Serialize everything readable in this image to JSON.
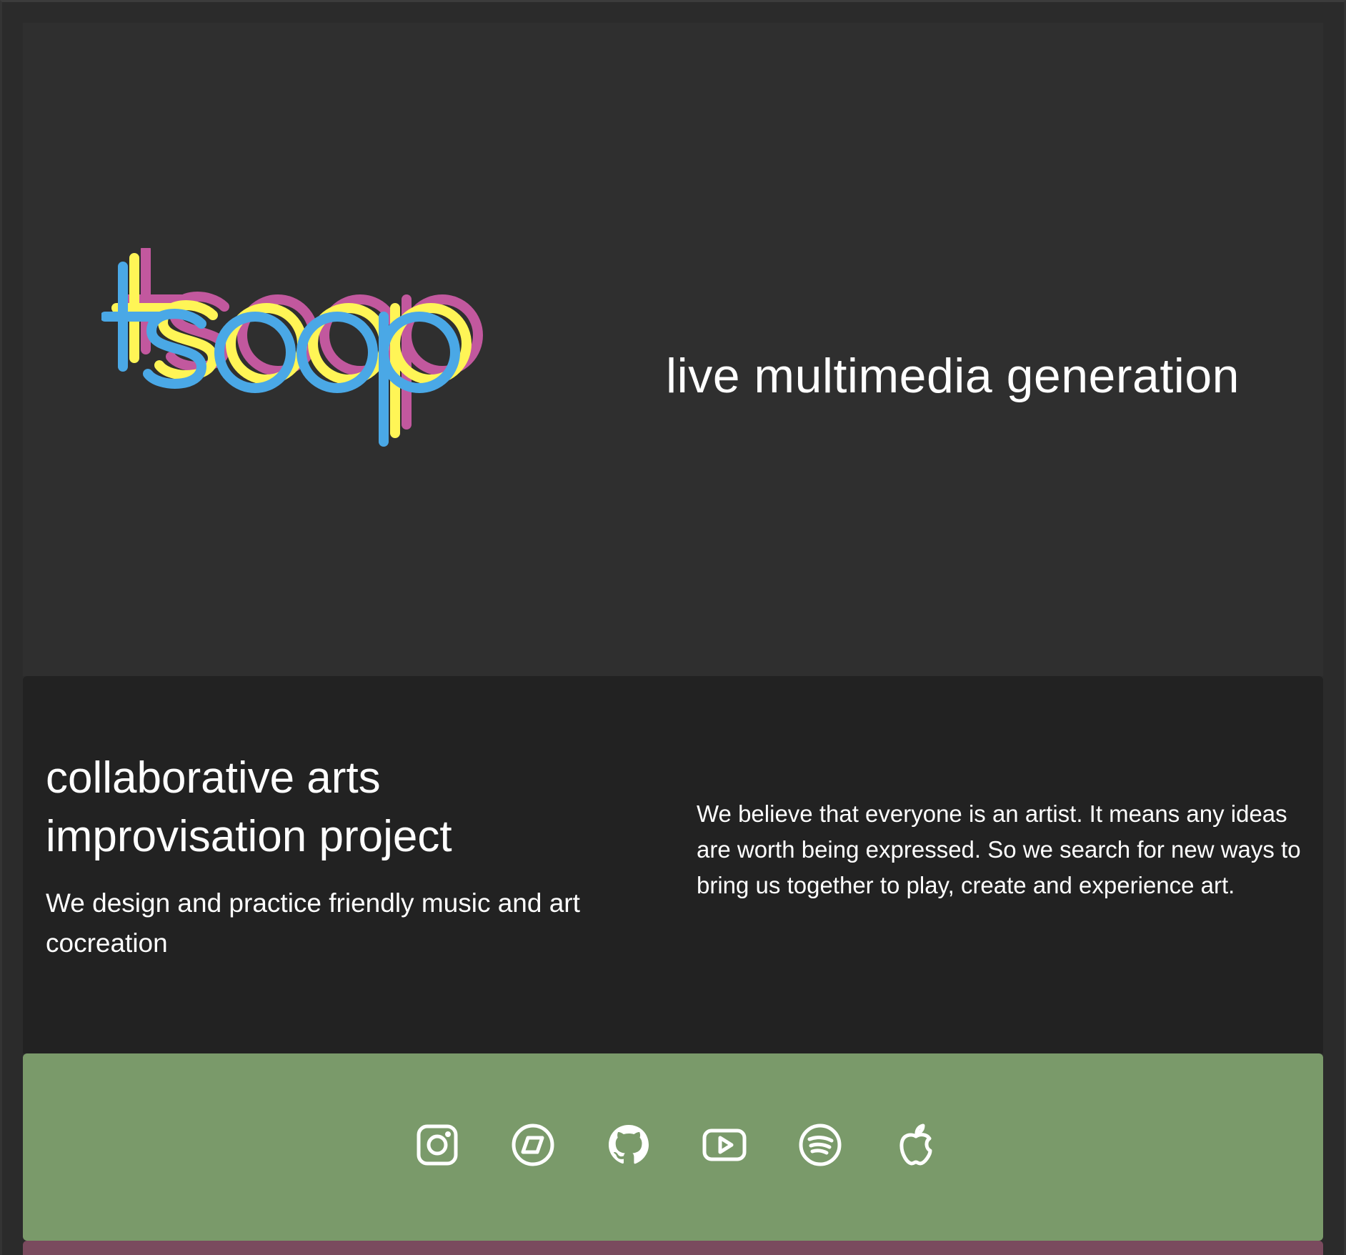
{
  "brand": {
    "logo_text": "tsoop",
    "logo_colors": {
      "magenta": "#c2589e",
      "yellow": "#fff556",
      "blue": "#4aa8e6"
    }
  },
  "hero": {
    "tagline": "live multimedia generation"
  },
  "about": {
    "title_line1": "collaborative arts",
    "title_line2": "improvisation project",
    "subtitle": "We design and practice friendly music and art cocreation",
    "description": "We believe that everyone is an artist. It means any ideas are worth being expressed. So we search for new ways to bring us together to play, create and experience art."
  },
  "social": {
    "background": "#7a9a6a",
    "links": [
      {
        "icon": "instagram-icon"
      },
      {
        "icon": "bandcamp-icon"
      },
      {
        "icon": "github-icon"
      },
      {
        "icon": "youtube-icon"
      },
      {
        "icon": "spotify-icon"
      },
      {
        "icon": "apple-music-icon"
      }
    ]
  },
  "colors": {
    "page_bg": "#2b2b2b",
    "hero_bg": "#2f2f2f",
    "about_bg": "#222222",
    "footer_strip": "#7a4a5e",
    "text": "#ffffff"
  }
}
